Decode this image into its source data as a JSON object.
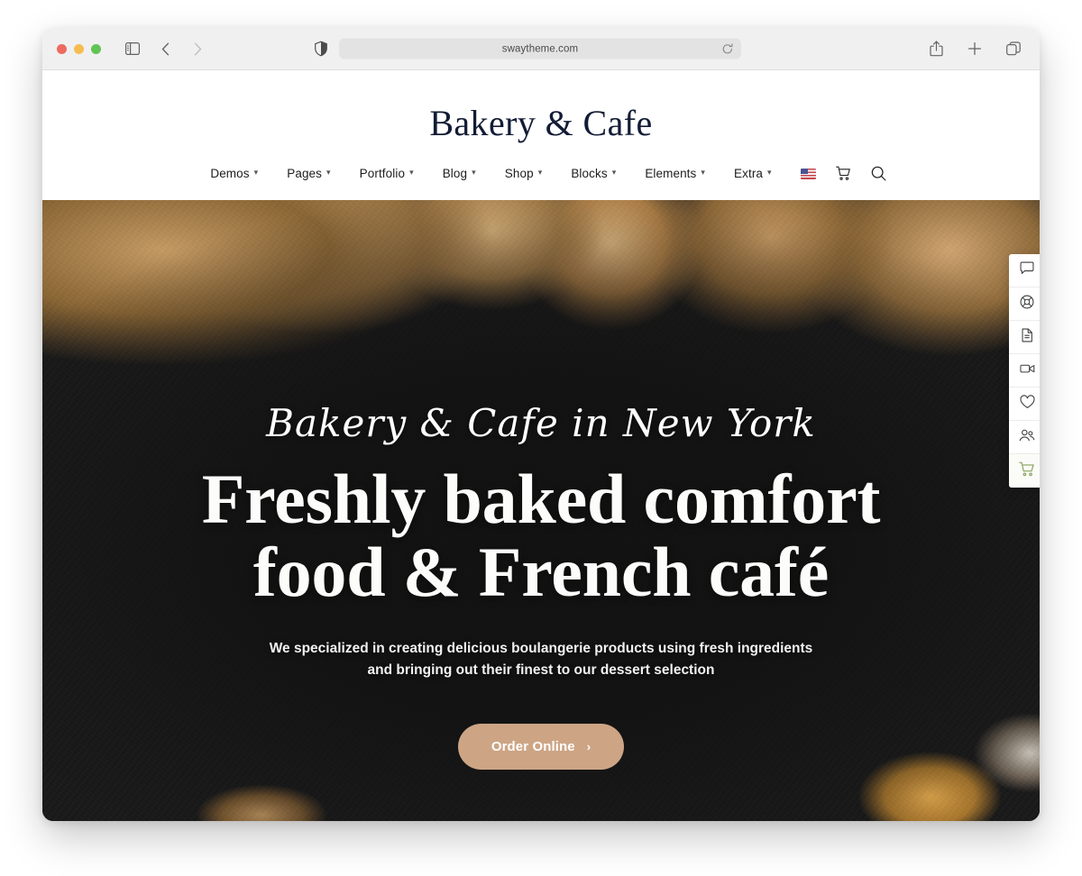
{
  "browser": {
    "url": "swaytheme.com",
    "controls": {
      "close": "close-window",
      "minimize": "minimize-window",
      "maximize": "maximize-window",
      "sidebar": "sidebar-toggle",
      "back": "back",
      "forward": "forward",
      "shield": "privacy-shield",
      "reload": "reload",
      "share": "share",
      "new_tab": "new-tab",
      "tab_overview": "tab-overview"
    }
  },
  "site": {
    "logo": "Bakery & Cafe",
    "nav": [
      {
        "label": "Demos",
        "has_caret": true
      },
      {
        "label": "Pages",
        "has_caret": true
      },
      {
        "label": "Portfolio",
        "has_caret": true
      },
      {
        "label": "Blog",
        "has_caret": true
      },
      {
        "label": "Shop",
        "has_caret": true
      },
      {
        "label": "Blocks",
        "has_caret": true
      },
      {
        "label": "Elements",
        "has_caret": true
      },
      {
        "label": "Extra",
        "has_caret": true
      }
    ],
    "nav_extras": {
      "language": "us-flag",
      "cart": "cart-icon",
      "search": "search-icon"
    }
  },
  "hero": {
    "script_text": "Bakery & Cafe in New York",
    "title_line1": "Freshly baked comfort",
    "title_line2": "food & French café",
    "subtitle_line1": "We specialized in creating delicious boulangerie products using fresh ingredients",
    "subtitle_line2": "and bringing out their finest to our dessert selection",
    "cta_label": "Order Online",
    "cta_arrow": "›",
    "cta_color": "#cda585",
    "background_color": "#181818"
  },
  "side_toolbar": {
    "active_color": "#8ba35e",
    "items": [
      {
        "name": "chat-icon",
        "label": "Chat"
      },
      {
        "name": "lifebuoy-icon",
        "label": "Support"
      },
      {
        "name": "document-icon",
        "label": "Documentation"
      },
      {
        "name": "video-icon",
        "label": "Video"
      },
      {
        "name": "heart-icon",
        "label": "Favorites"
      },
      {
        "name": "users-icon",
        "label": "Community"
      },
      {
        "name": "cart-icon",
        "label": "Purchase"
      }
    ]
  }
}
